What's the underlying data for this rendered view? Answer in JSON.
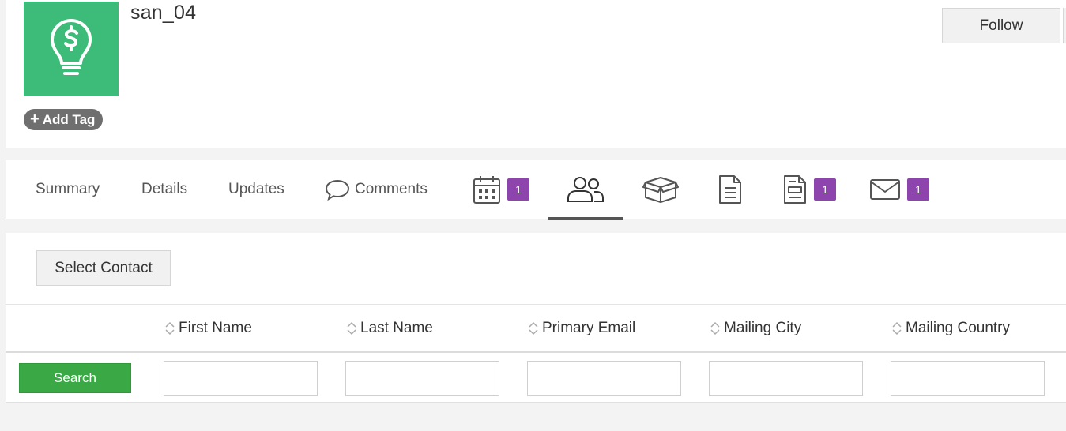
{
  "record": {
    "name": "san_04",
    "add_tag_label": "Add Tag",
    "follow_label": "Follow",
    "avatar_icon": "lightbulb-dollar-icon",
    "avatar_color": "#3dbb78"
  },
  "tabs": [
    {
      "label": "Summary"
    },
    {
      "label": "Details"
    },
    {
      "label": "Updates"
    },
    {
      "label": "Comments",
      "icon": "comment-icon"
    },
    {
      "icon": "calendar-icon",
      "badge": "1"
    },
    {
      "icon": "contacts-icon",
      "active": true
    },
    {
      "icon": "box-icon"
    },
    {
      "icon": "document-icon"
    },
    {
      "icon": "invoice-icon",
      "badge": "1"
    },
    {
      "icon": "mail-icon",
      "badge": "1"
    }
  ],
  "badge_color": "#8e44ad",
  "contacts": {
    "select_label": "Select Contact",
    "columns": [
      "First Name",
      "Last Name",
      "Primary Email",
      "Mailing City",
      "Mailing Country"
    ],
    "search_label": "Search",
    "search_color": "#39a845"
  }
}
